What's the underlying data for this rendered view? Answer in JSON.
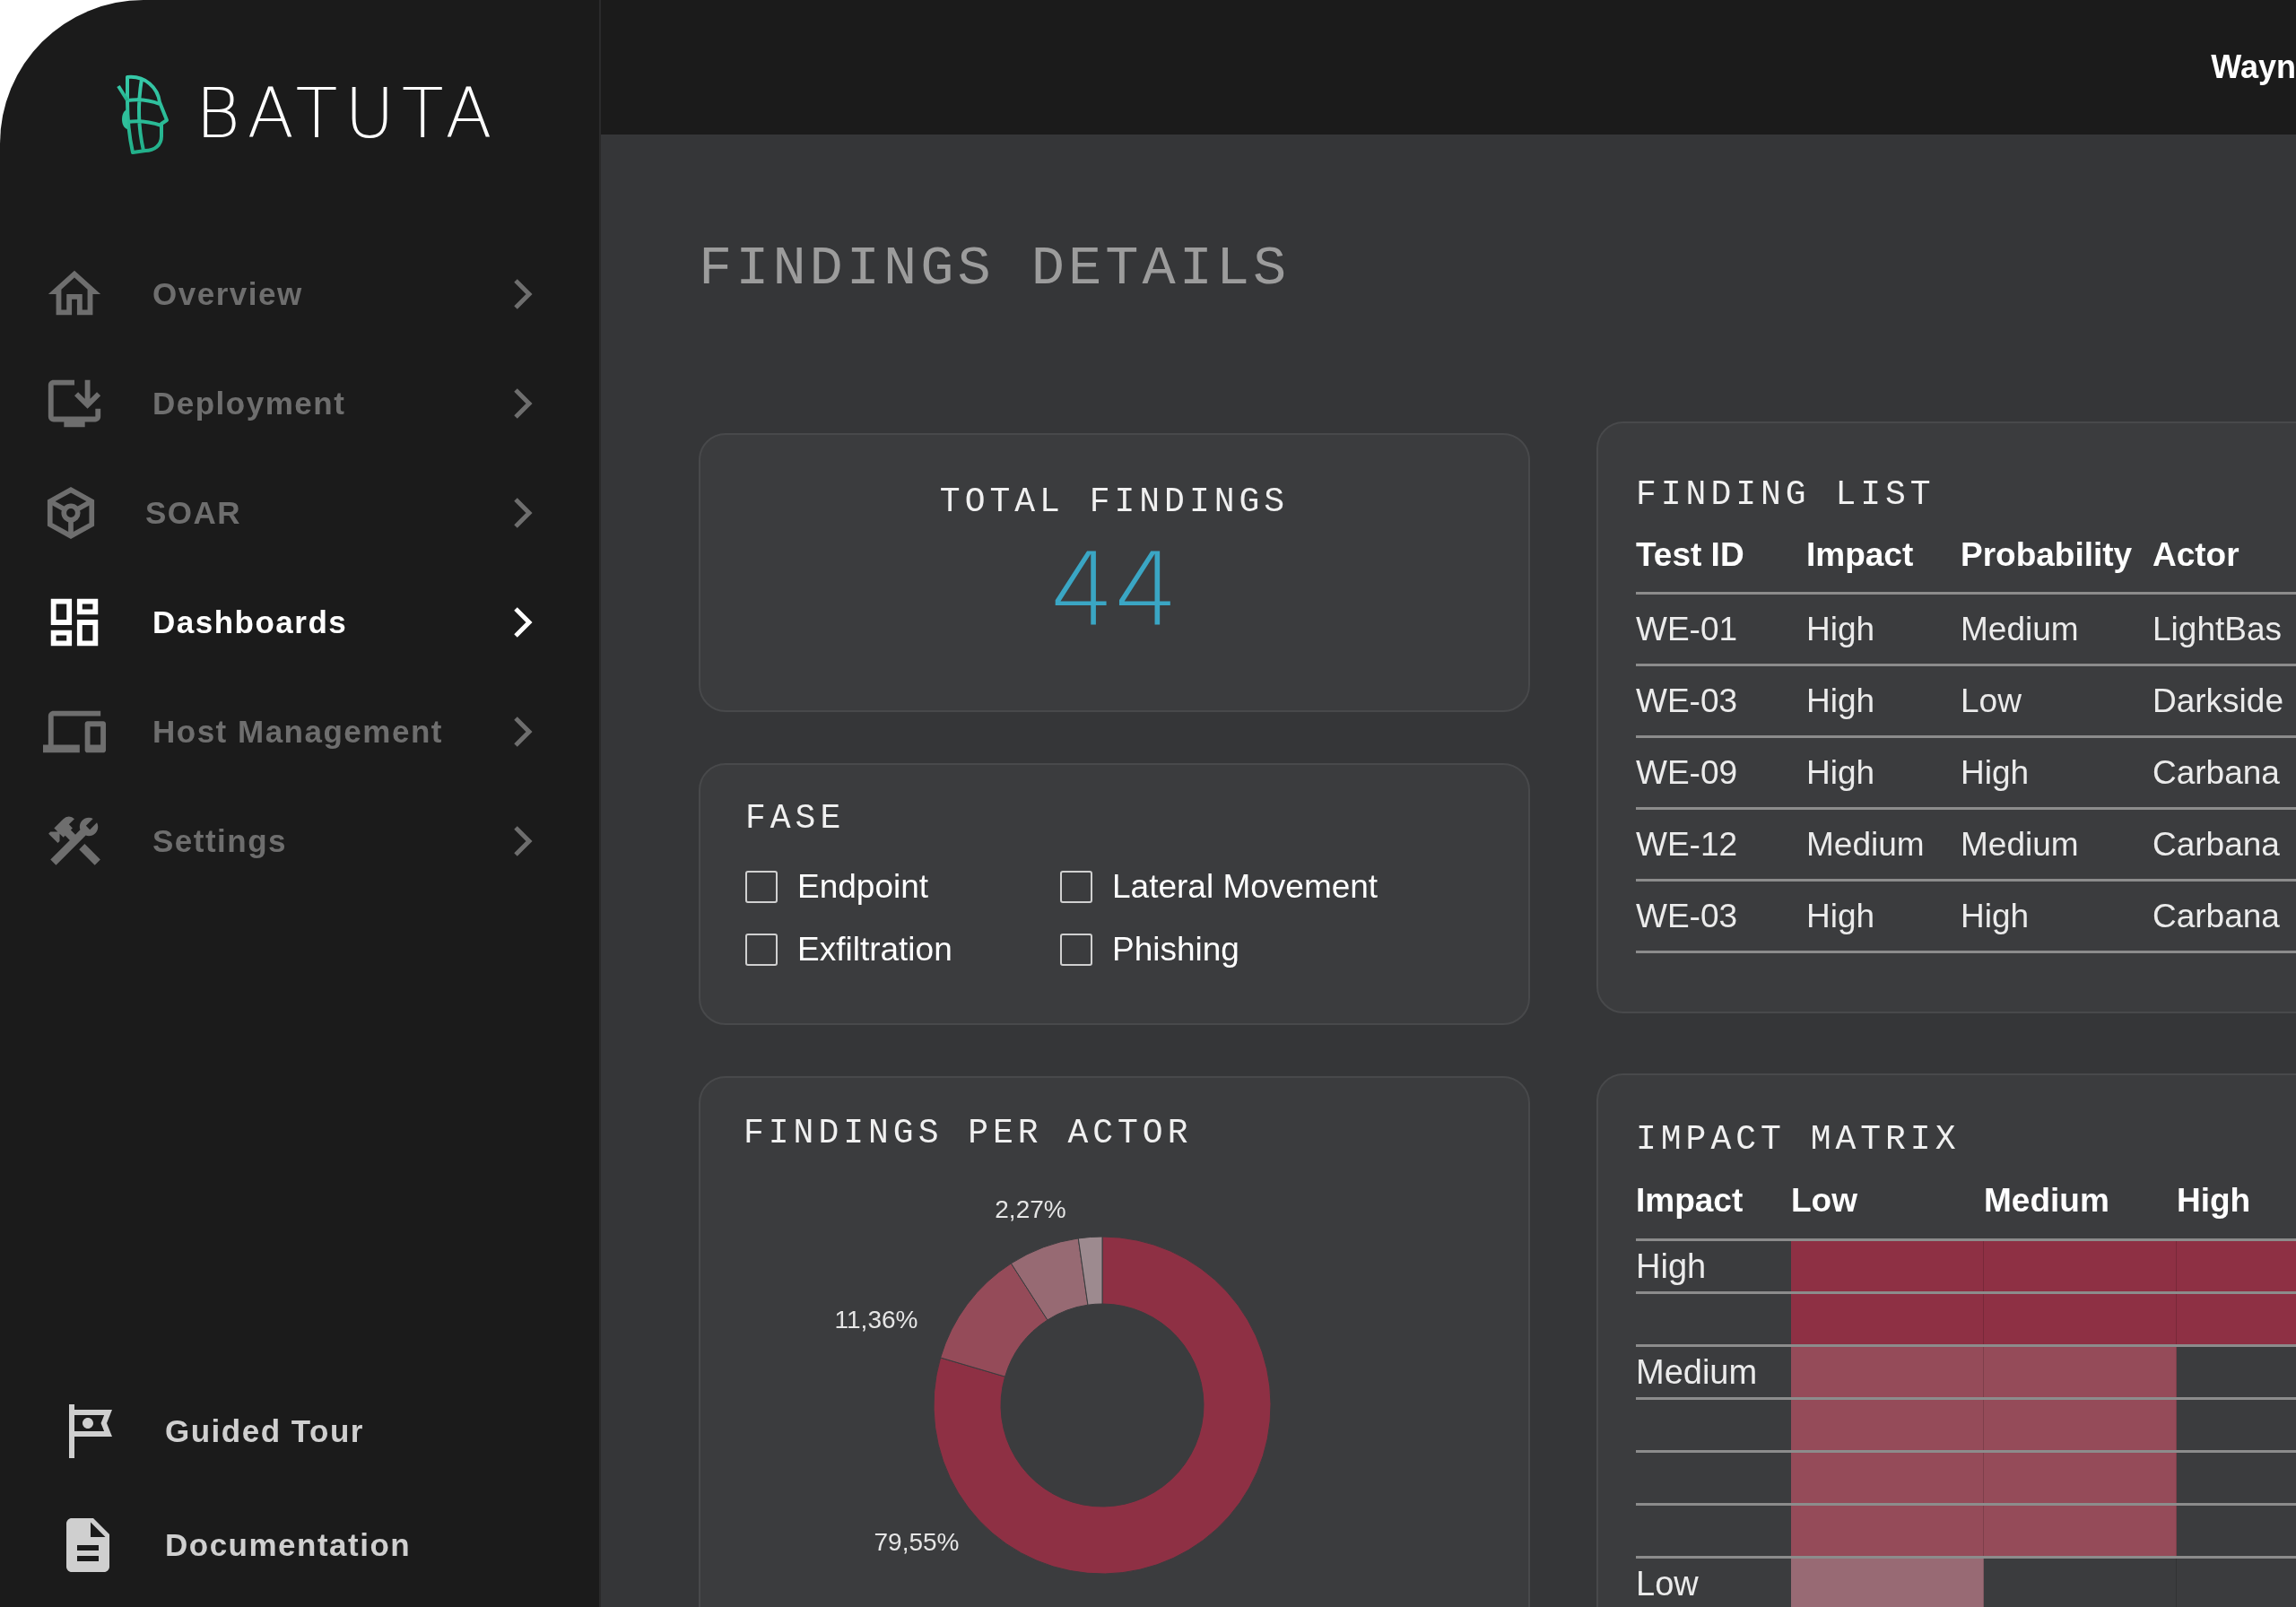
{
  "brand": {
    "name": "BATUTA"
  },
  "sidebar": {
    "items": [
      {
        "label": "Overview",
        "selected": false
      },
      {
        "label": "Deployment",
        "selected": false
      },
      {
        "label": "SOAR",
        "selected": false
      },
      {
        "label": "Dashboards",
        "selected": true
      },
      {
        "label": "Host Management",
        "selected": false
      },
      {
        "label": "Settings",
        "selected": false
      }
    ],
    "footer_items": [
      {
        "label": "Guided Tour"
      },
      {
        "label": "Documentation"
      }
    ]
  },
  "header": {
    "user": "Wayn"
  },
  "page": {
    "title": "FINDINGS DETAILS"
  },
  "total_findings": {
    "title": "TOTAL FINDINGS",
    "value": "44"
  },
  "fase": {
    "title": "FASE",
    "options": [
      {
        "label": "Endpoint",
        "checked": false
      },
      {
        "label": "Lateral Movement",
        "checked": false
      },
      {
        "label": "Exfiltration",
        "checked": false
      },
      {
        "label": "Phishing",
        "checked": false
      }
    ]
  },
  "findings_per_actor": {
    "title": "FINDINGS PER ACTOR",
    "chart_data": {
      "type": "donut",
      "values": [
        79.55,
        11.36,
        6.82,
        2.27
      ],
      "colors": [
        "#8e3044",
        "#954b59",
        "#976a73",
        "#9d8a8f"
      ],
      "value_labels": [
        "79,55%",
        "11,36%",
        null,
        "2,27%"
      ]
    }
  },
  "finding_list": {
    "title": "FINDING LIST",
    "columns": [
      "Test ID",
      "Impact",
      "Probability",
      "Actor"
    ],
    "rows": [
      [
        "WE-01",
        "High",
        "Medium",
        "LightBas"
      ],
      [
        "WE-03",
        "High",
        "Low",
        "Darkside"
      ],
      [
        "WE-09",
        "High",
        "High",
        "Carbana"
      ],
      [
        "WE-12",
        "Medium",
        "Medium",
        "Carbana"
      ],
      [
        "WE-03",
        "High",
        "High",
        "Carbana"
      ]
    ]
  },
  "impact_matrix": {
    "title": "IMPACT MATRIX",
    "columns": [
      "Impact",
      "Low",
      "Medium",
      "High"
    ],
    "rows": [
      {
        "label": "High",
        "cells": [
          {
            "color": "#8e3044"
          },
          {
            "color": "#8e3044"
          },
          {
            "color": "#8e3044"
          }
        ]
      },
      {
        "cells": [
          {
            "color": "#8e3044"
          },
          {
            "color": "#8e3044"
          },
          {
            "color": "#8e3044"
          }
        ]
      },
      {
        "label": "Medium",
        "cells": [
          {
            "color": "#954b59"
          },
          {
            "color": "#954b59"
          }
        ]
      },
      {
        "cells": [
          {
            "color": "#954b59"
          },
          {
            "color": "#954b59"
          }
        ]
      },
      {
        "cells": [
          {
            "color": "#954b59"
          },
          {
            "color": "#954b59"
          }
        ]
      },
      {
        "cells": [
          {
            "color": "#954b59"
          },
          {
            "color": "#954b59"
          }
        ]
      },
      {
        "label": "Low",
        "cells": [
          {
            "color": "#986a74"
          }
        ]
      }
    ]
  }
}
